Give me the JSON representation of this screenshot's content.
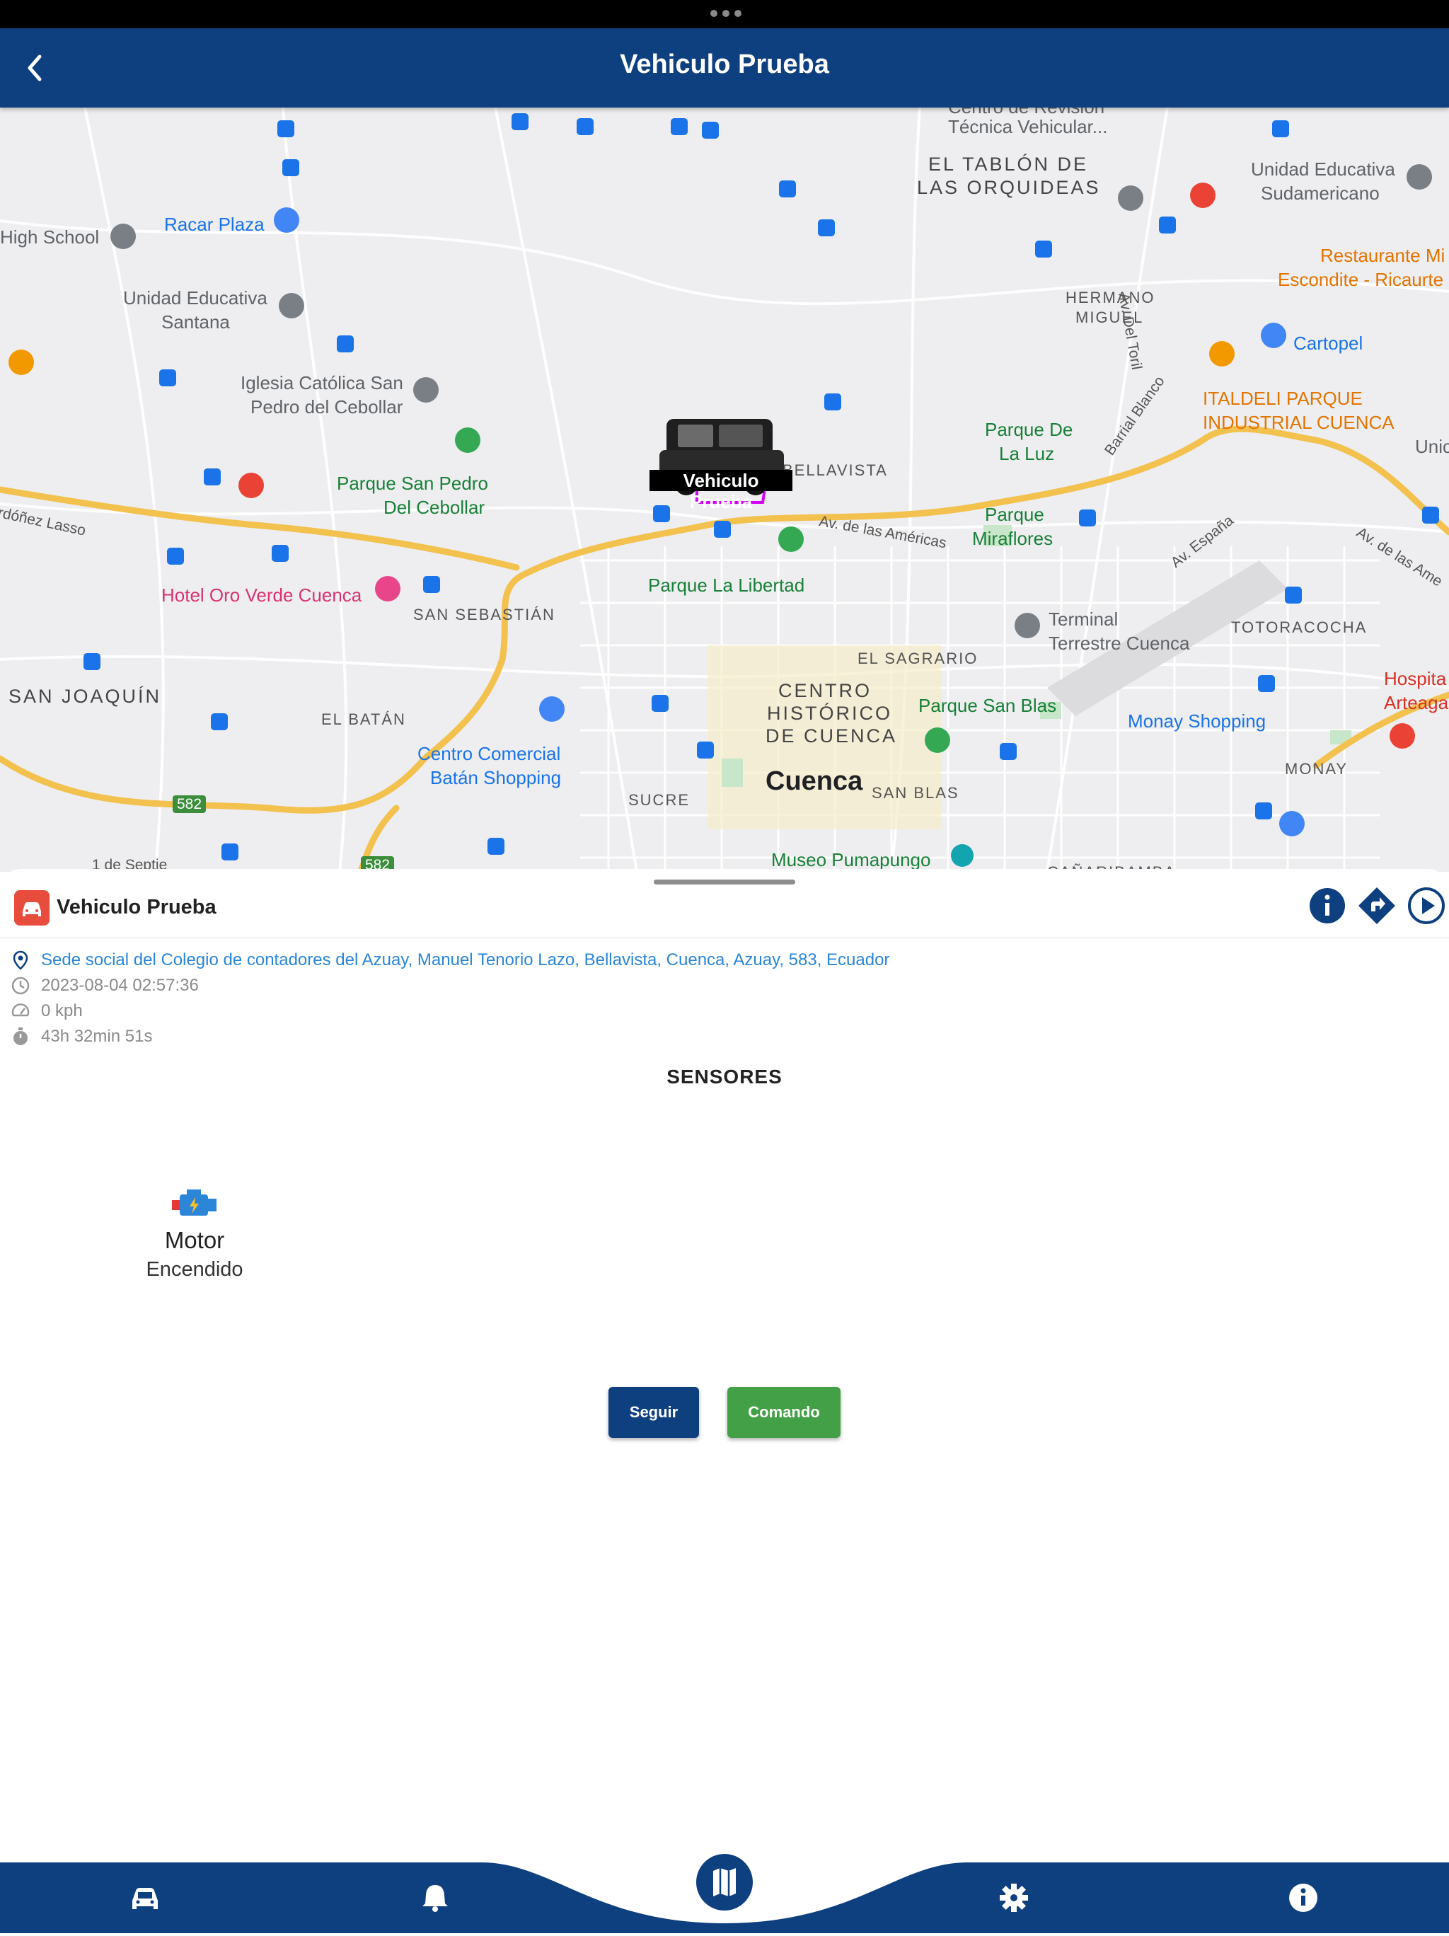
{
  "window": {
    "title": "Vehiculo Prueba"
  },
  "map": {
    "vehicle_label": "Vehiculo Prueba",
    "labels": {
      "centro_revision": "Centro de Revisión",
      "tecnica_vehicular": "Técnica Vehicular...",
      "tablon_1": "EL TABLÓN DE",
      "tablon_2": "LAS ORQUIDEAS",
      "unidad_sudam_1": "Unidad Educativa",
      "unidad_sudam_2": "Sudamericano",
      "high_school": "High School",
      "racar_plaza": "Racar Plaza",
      "restaurante_1": "Restaurante Mi",
      "restaurante_2": "Escondite - Ricaurte",
      "hermano_1": "HERMANO",
      "hermano_2": "MIGUEL",
      "av_del_toril": "Av. Del Toril",
      "unidad_santana_1": "Unidad Educativa",
      "unidad_santana_2": "Santana",
      "cartopel": "Cartopel",
      "iglesia_1": "Iglesia Católica San",
      "iglesia_2": "Pedro del Cebollar",
      "barrial_blanco": "Barrial Blanco",
      "italdeli_1": "ITALDELI PARQUE",
      "italdeli_2": "INDUSTRIAL CUENCA",
      "parque_luz_1": "Parque De",
      "parque_luz_2": "La Luz",
      "unic": "Unic",
      "bellavista": "BELLAVISTA",
      "parque_san_pedro_1": "Parque San Pedro",
      "parque_san_pedro_2": "Del Cebollar",
      "ordonez_lasso": "rdóñez Lasso",
      "av_americas": "Av. de las Américas",
      "parque_miraflores_1": "Parque",
      "parque_miraflores_2": "Miraflores",
      "av_espana": "Av. España",
      "av_americas_2": "Av. de las Ame",
      "parque_libertad": "Parque La Libertad",
      "hotel_oro_verde": "Hotel Oro Verde Cuenca",
      "san_sebastian": "SAN SEBASTIÁN",
      "terminal_1": "Terminal",
      "terminal_2": "Terrestre Cuenca",
      "totoracocha": "TOTORACOCHA",
      "el_sagrario": "EL SAGRARIO",
      "hospital_1": "Hospita",
      "hospital_2": "Arteaga",
      "san_joaquin": "SAN JOAQUÍN",
      "centro_1": "CENTRO",
      "centro_2": "HISTÓRICO",
      "centro_3": "DE CUENCA",
      "parque_san_blas": "Parque San Blas",
      "el_batan": "EL BATÁN",
      "monay_shopping": "Monay Shopping",
      "centro_comercial_1": "Centro Comercial",
      "centro_comercial_2": "Batán Shopping",
      "monay": "MONAY",
      "cuenca": "Cuenca",
      "sucre": "SUCRE",
      "san_blas": "SAN BLAS",
      "route_582": "582",
      "route_582b": "582",
      "primero_sept": "1 de Septie",
      "museo": "Museo Pumapungo",
      "canaribamba": "CAÑARIBAMBA"
    }
  },
  "vehicle_panel": {
    "name": "Vehiculo Prueba",
    "address": "Sede social del Colegio de contadores del Azuay, Manuel Tenorio Lazo, Bellavista, Cuenca, Azuay, 583, Ecuador",
    "timestamp": "2023-08-04 02:57:36",
    "speed": "0 kph",
    "duration": "43h 32min 51s",
    "sensors_title": "SENSORES",
    "sensors": [
      {
        "name": "Motor",
        "value": "Encendido",
        "icon": "engine-icon"
      }
    ],
    "buttons": {
      "seguir": "Seguir",
      "comando": "Comando"
    }
  },
  "actions": [
    "info-icon",
    "directions-icon",
    "play-icon"
  ],
  "navbar": [
    "car-icon",
    "bell-icon",
    "map-icon",
    "gear-icon",
    "info-icon"
  ],
  "colors": {
    "primary": "#0e3f7e",
    "accent_green": "#43a047",
    "badge_red": "#e84c3d",
    "link_blue": "#2b86d8",
    "road_yellow": "#f2c14e"
  }
}
